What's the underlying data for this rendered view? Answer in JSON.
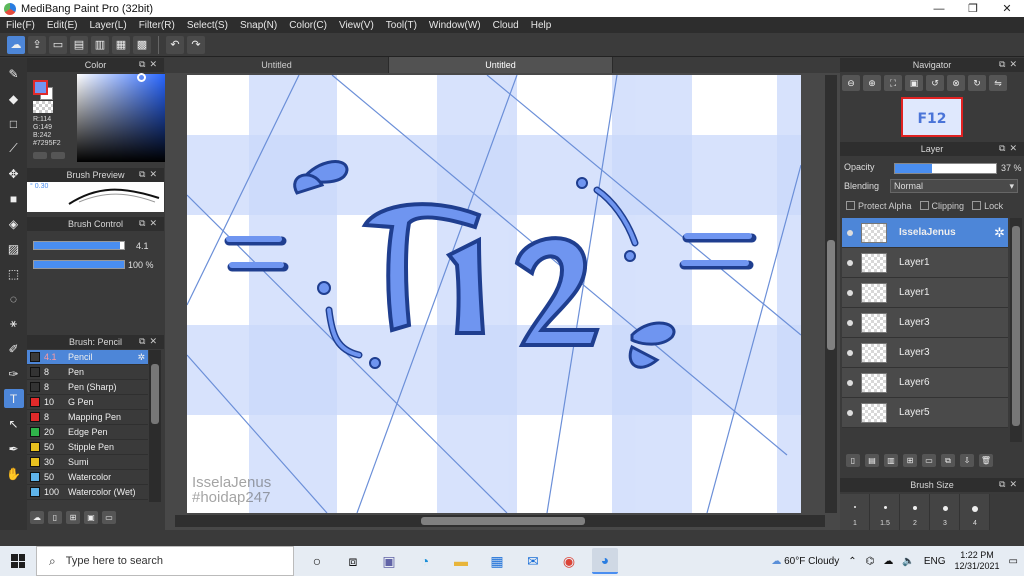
{
  "window": {
    "title": "MediBang Paint Pro (32bit)"
  },
  "menu": [
    "File(F)",
    "Edit(E)",
    "Layer(L)",
    "Filter(R)",
    "Select(S)",
    "Snap(N)",
    "Color(C)",
    "View(V)",
    "Tool(T)",
    "Window(W)",
    "Cloud",
    "Help"
  ],
  "color_panel": {
    "title": "Color",
    "r": "R:114",
    "g": "G:149",
    "b": "B:242",
    "hex": "#7295F2",
    "current_color": "#7295f2"
  },
  "brush_preview": {
    "title": "Brush Preview",
    "size": "0.30"
  },
  "brush_control": {
    "title": "Brush Control",
    "size_value": "4.1",
    "opacity_value": "100 %",
    "size_fill": 0.95,
    "opacity_fill": 1.0
  },
  "brush_list": {
    "title": "Brush: Pencil",
    "items": [
      {
        "size": "4.1",
        "name": "Pencil",
        "color": "#3a3a3a",
        "selected": true
      },
      {
        "size": "8",
        "name": "Pen",
        "color": "#333333"
      },
      {
        "size": "8",
        "name": "Pen (Sharp)",
        "color": "#333333"
      },
      {
        "size": "10",
        "name": "G Pen",
        "color": "#e02a2a"
      },
      {
        "size": "8",
        "name": "Mapping Pen",
        "color": "#e02a2a"
      },
      {
        "size": "20",
        "name": "Edge Pen",
        "color": "#2fb34a"
      },
      {
        "size": "50",
        "name": "Stipple Pen",
        "color": "#e8c11f"
      },
      {
        "size": "30",
        "name": "Sumi",
        "color": "#e8c11f"
      },
      {
        "size": "50",
        "name": "Watercolor",
        "color": "#5fb4ea"
      },
      {
        "size": "100",
        "name": "Watercolor (Wet)",
        "color": "#5fb4ea"
      }
    ]
  },
  "canvas": {
    "tabs": [
      {
        "label": "Untitled"
      },
      {
        "label": "Untitled"
      }
    ],
    "artwork_text": "F12",
    "watermark_line1": "IsselaJenus",
    "watermark_line2": "#hoidap247"
  },
  "navigator": {
    "title": "Navigator"
  },
  "layer_panel": {
    "title": "Layer",
    "opacity_label": "Opacity",
    "opacity_value": "37 %",
    "blending_label": "Blending",
    "blending_value": "Normal",
    "protect_alpha": "Protect Alpha",
    "clipping": "Clipping",
    "lock": "Lock",
    "layers": [
      {
        "name": "IsselaJenus",
        "selected": true
      },
      {
        "name": "Layer1"
      },
      {
        "name": "Layer1"
      },
      {
        "name": "Layer3"
      },
      {
        "name": "Layer3"
      },
      {
        "name": "Layer6"
      },
      {
        "name": "Layer5"
      }
    ]
  },
  "brush_size": {
    "title": "Brush Size",
    "sizes": [
      "1",
      "1.5",
      "2",
      "3",
      "4"
    ]
  },
  "taskbar": {
    "search_placeholder": "Type here to search",
    "weather": "60°F  Cloudy",
    "lang": "ENG",
    "time": "1:22 PM",
    "date": "12/31/2021"
  },
  "colors": {
    "accent": "#4d86d8",
    "artwork_blue": "#6f95f0",
    "artwork_dark": "#1f3e8f"
  }
}
